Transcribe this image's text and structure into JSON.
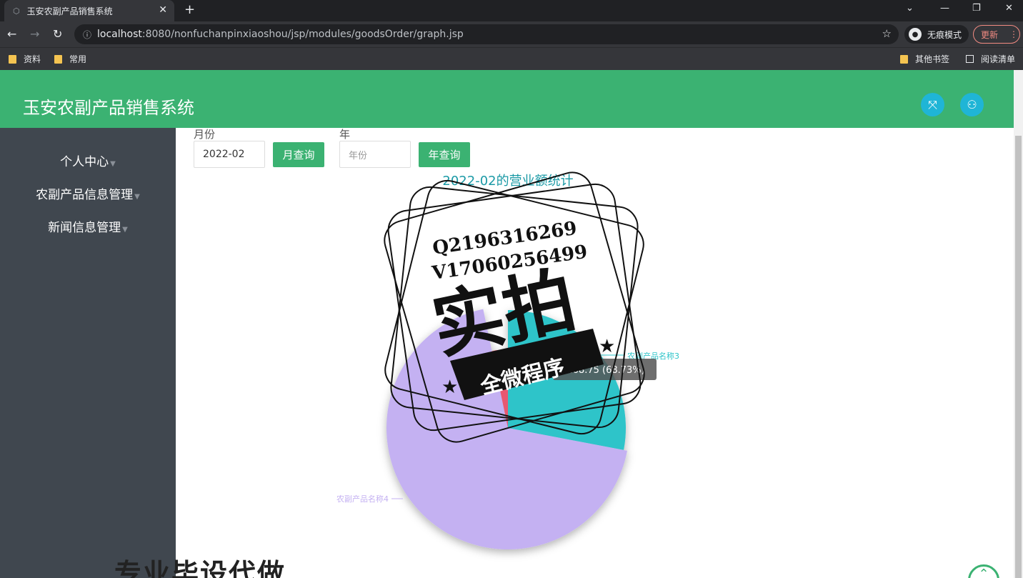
{
  "browser": {
    "tab_title": "玉安农副产品销售系统",
    "url_host": "localhost",
    "url_rest": ":8080/nonfuchanpinxiaoshou/jsp/modules/goodsOrder/graph.jsp",
    "incognito_label": "无痕模式",
    "update_label": "更新",
    "bookmarks": [
      "资料",
      "常用"
    ],
    "other_bookmarks": "其他书签",
    "reading_list": "阅读清单"
  },
  "header": {
    "title": "玉安农副产品销售系统"
  },
  "sidebar": {
    "items": [
      {
        "label": "个人中心"
      },
      {
        "label": "农副产品信息管理"
      },
      {
        "label": "新闻信息管理"
      }
    ]
  },
  "filters": {
    "month_label": "月份",
    "month_value": "2022-02",
    "month_button": "月查询",
    "year_label": "年",
    "year_placeholder": "年份",
    "year_button": "年查询"
  },
  "chart_data": {
    "type": "pie",
    "title": "2022-02的营业额统计",
    "slices": [
      {
        "name": "农副产品名称3",
        "value_fraction": 0.28,
        "color": "#2ec4c9"
      },
      {
        "name": "农副产品名称4",
        "value_fraction": 0.6873,
        "color": "#c4b1f2"
      },
      {
        "name": "",
        "value_fraction": 0.0327,
        "color": "#e8596f"
      }
    ],
    "tooltip": "...68.75 (68.73%)"
  },
  "watermark": {
    "line1": "Q2196316269",
    "line2": "V17060256499",
    "big": "实拍",
    "banner": "全微程序",
    "bottom": "专业毕设代做"
  },
  "colors": {
    "header_green": "#3bb272",
    "sidebar": "#40474f",
    "accent_cyan": "#1fb5d6"
  }
}
